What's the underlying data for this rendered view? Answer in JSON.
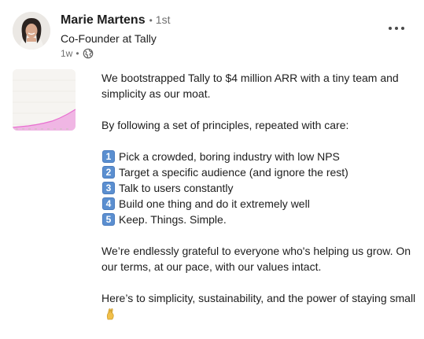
{
  "post": {
    "author": {
      "name": "Marie Martens",
      "separator": "•",
      "degree": "1st",
      "headline": "Co-Founder at Tally"
    },
    "meta": {
      "time": "1w",
      "separator": "•",
      "visibility_icon": "globe-icon"
    },
    "more_icon": "more-horizontal-icon",
    "paragraphs": [
      "We bootstrapped Tally to $4 million ARR with a tiny team and simplicity as our moat.",
      "By following a set of principles, repeated with care:"
    ],
    "list": [
      {
        "badge": "1",
        "text": "Pick a crowded, boring industry with low NPS"
      },
      {
        "badge": "2",
        "text": "Target a specific audience (and ignore the rest)"
      },
      {
        "badge": "3",
        "text": "Talk to users constantly"
      },
      {
        "badge": "4",
        "text": "Build one thing and do it extremely well"
      },
      {
        "badge": "5",
        "text": "Keep. Things. Simple."
      }
    ],
    "closing": "We’re endlessly grateful to everyone who's helping us grow. On our terms, at our pace, with our values intact.",
    "final": "Here’s to simplicity, sustainability, and the power of staying small",
    "final_emoji_icon": "pinched-fingers-hand-icon"
  },
  "colors": {
    "text": "#1d1d1d",
    "muted": "#707070",
    "badge": "#5b8fd0",
    "chart_fill": "#e86fd0"
  }
}
